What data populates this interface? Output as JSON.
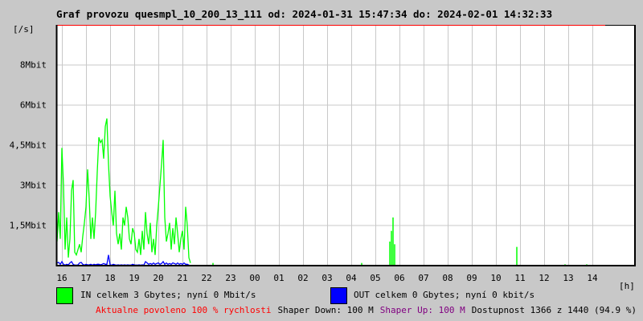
{
  "header": {
    "title": "Graf provozu quesmpl_10_200_13_111 od: 2024-01-31 15:47:34 do: 2024-02-01 14:32:33"
  },
  "chart_data": {
    "type": "line",
    "title": "Graf provozu quesmpl_10_200_13_111 od: 2024-01-31 15:47:34 do: 2024-02-01 14:32:33",
    "ylabel": "[/s]",
    "xlabel": "[h]",
    "ylim_mbit": [
      0,
      9
    ],
    "y_ticks": [
      {
        "value": 7.5,
        "label": "8Mbit"
      },
      {
        "value": 6,
        "label": "6Mbit"
      },
      {
        "value": 4.5,
        "label": "4,5Mbit"
      },
      {
        "value": 3,
        "label": "3Mbit"
      },
      {
        "value": 1.5,
        "label": "1,5Mbit"
      }
    ],
    "x_ticks": [
      "16",
      "17",
      "18",
      "19",
      "20",
      "21",
      "22",
      "23",
      "00",
      "01",
      "02",
      "03",
      "04",
      "05",
      "06",
      "07",
      "08",
      "09",
      "10",
      "11",
      "12",
      "13",
      "14"
    ],
    "grid": true,
    "series": [
      {
        "name": "IN",
        "color": "#00ff00",
        "start": "15:48",
        "step_minutes": 4,
        "values": [
          0.9,
          2.0,
          1.0,
          4.4,
          3.0,
          0.6,
          1.8,
          0.3,
          1.0,
          2.8,
          3.2,
          0.5,
          0.4,
          0.6,
          0.8,
          0.5,
          1.1,
          1.6,
          2.2,
          3.6,
          2.5,
          1.0,
          1.8,
          1.0,
          2.0,
          3.5,
          4.8,
          4.6,
          4.7,
          4.0,
          5.2,
          5.5,
          3.8,
          2.6,
          2.0,
          1.5,
          2.8,
          1.2,
          0.8,
          1.2,
          0.6,
          1.8,
          1.5,
          2.2,
          1.8,
          1.0,
          0.8,
          1.4,
          1.2,
          0.6,
          0.5,
          1.0,
          0.4,
          1.3,
          0.6,
          2.0,
          1.2,
          0.8,
          1.6,
          0.5,
          1.0,
          0.4,
          1.5,
          2.2,
          3.0,
          3.8,
          4.7,
          1.8,
          0.9,
          1.2,
          1.6,
          0.6,
          1.4,
          0.8,
          1.8,
          1.2,
          0.5,
          1.0,
          1.3,
          0.6,
          2.2,
          1.5,
          0.3,
          0.1
        ],
        "spikes": [
          [
            "22:16",
            0.1
          ],
          [
            "04:26",
            0.1
          ],
          [
            "05:36",
            0.9
          ],
          [
            "05:40",
            1.3
          ],
          [
            "05:44",
            1.8
          ],
          [
            "05:48",
            0.8
          ],
          [
            "10:52",
            0.7
          ],
          [
            "12:52",
            0.05
          ],
          [
            "13:46",
            0.05
          ]
        ]
      },
      {
        "name": "OUT",
        "color": "#0000ff",
        "start": "15:48",
        "step_minutes": 4,
        "values": [
          0.1,
          0.12,
          0.05,
          0.15,
          0.05,
          0.02,
          0.05,
          0.03,
          0.1,
          0.15,
          0.05,
          0.02,
          0.02,
          0.03,
          0.1,
          0.12,
          0.05,
          0.02,
          0.05,
          0.03,
          0.03,
          0.05,
          0.02,
          0.05,
          0.03,
          0.05,
          0.05,
          0.03,
          0.05,
          0.08,
          0.05,
          0.05,
          0.4,
          0.03,
          0.02,
          0.05,
          0.03,
          0.02,
          0.03,
          0.02,
          0.03,
          0.02,
          0.03,
          0.02,
          0.03,
          0.02,
          0.02,
          0.05,
          0.03,
          0.02,
          0.02,
          0.03,
          0.02,
          0.03,
          0.02,
          0.15,
          0.1,
          0.05,
          0.08,
          0.05,
          0.1,
          0.05,
          0.08,
          0.1,
          0.05,
          0.08,
          0.15,
          0.05,
          0.1,
          0.05,
          0.08,
          0.05,
          0.1,
          0.08,
          0.05,
          0.1,
          0.05,
          0.08,
          0.05,
          0.1,
          0.05,
          0.05,
          0.02,
          0.0
        ],
        "spikes": []
      }
    ]
  },
  "legend": {
    "in_label": "IN celkem 3 Gbytes; nyní 0 Mbit/s",
    "out_label": "OUT celkem 0 Gbytes; nyní 0 kbit/s",
    "in_color": "#00ff00",
    "out_color": "#0000ff"
  },
  "status": {
    "allowed": "Aktualne povoleno 100 % rychlosti",
    "shaper_down": "Shaper Down: 100 M",
    "shaper_up": "Shaper Up: 100 M",
    "availability": "Dostupnost 1366 z 1440 (94.9 %)",
    "allowed_color": "#ff0000",
    "shaper_up_color": "#800080"
  }
}
